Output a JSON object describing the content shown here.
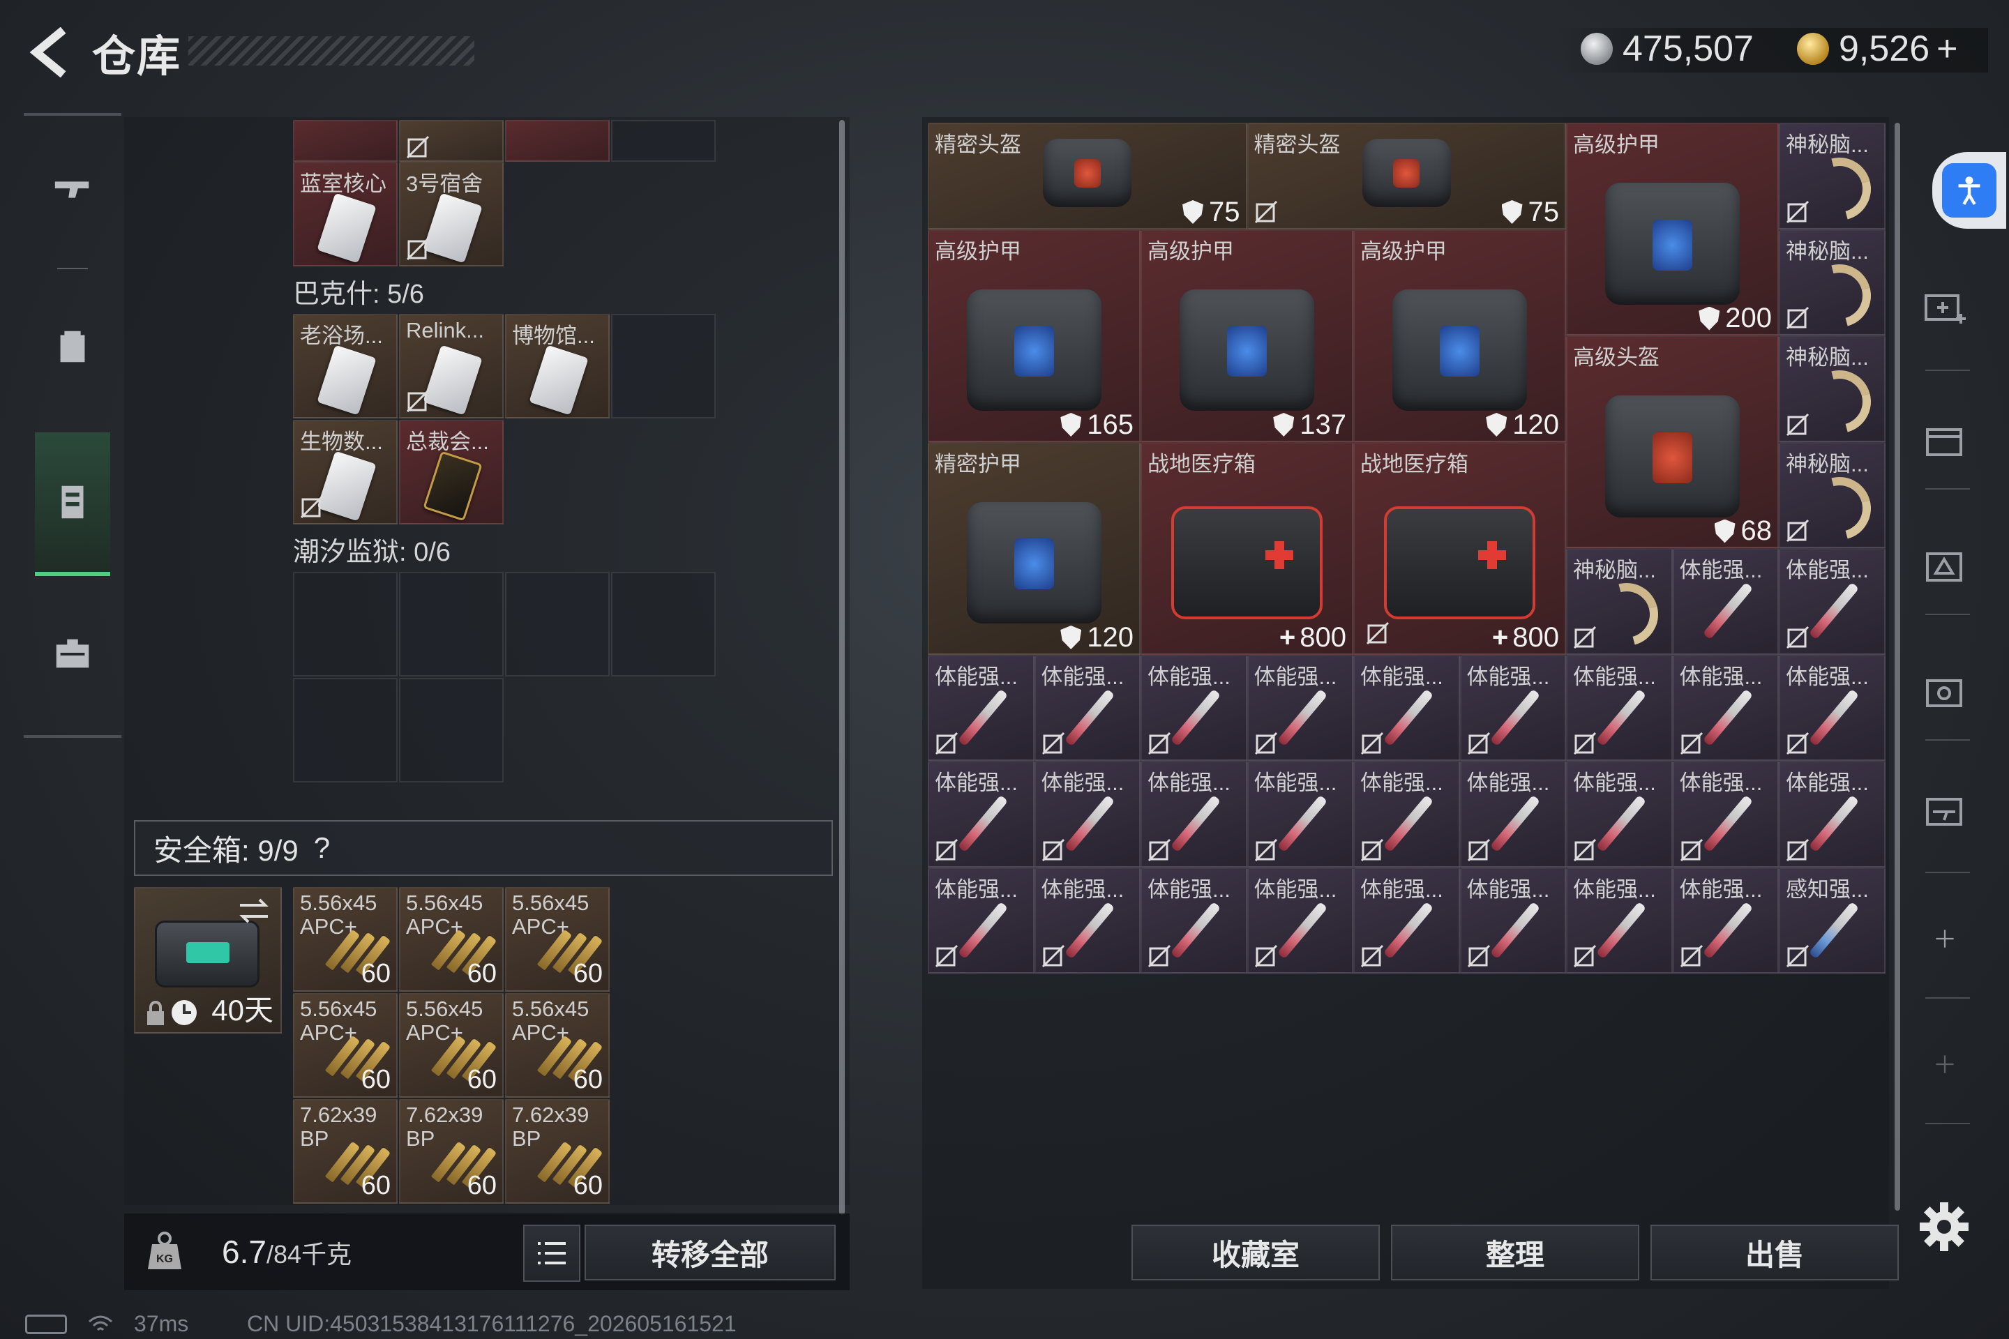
{
  "header": {
    "title": "仓库",
    "silver": "475,507",
    "gold": "9,526",
    "gold_plus": "+"
  },
  "left": {
    "top_row_partial": [
      {
        "color": "red"
      },
      {
        "color": "brown",
        "locked": true
      },
      {
        "color": "red"
      }
    ],
    "row1": [
      {
        "label": "蓝室核心",
        "color": "red"
      },
      {
        "label": "3号宿舍",
        "color": "brown",
        "locked": true
      }
    ],
    "section_baks": "巴克什: 5/6",
    "row2": [
      {
        "label": "老浴场...",
        "color": "brown"
      },
      {
        "label": "Relink...",
        "color": "brown",
        "locked": true
      },
      {
        "label": "博物馆...",
        "color": "brown"
      }
    ],
    "row3": [
      {
        "label": "生物数...",
        "color": "brown",
        "locked": true
      },
      {
        "label": "总裁会...",
        "color": "red",
        "black": true
      }
    ],
    "section_tide": "潮汐监狱: 0/6",
    "safebox": {
      "label": "安全箱: 9/9",
      "help": "?",
      "days": "40天"
    },
    "ammo": [
      {
        "l1": "5.56x45",
        "l2": "APC+",
        "count": "60"
      },
      {
        "l1": "5.56x45",
        "l2": "APC+",
        "count": "60"
      },
      {
        "l1": "5.56x45",
        "l2": "APC+",
        "count": "60"
      },
      {
        "l1": "5.56x45",
        "l2": "APC+",
        "count": "60"
      },
      {
        "l1": "5.56x45",
        "l2": "APC+",
        "count": "60"
      },
      {
        "l1": "5.56x45",
        "l2": "APC+",
        "count": "60"
      },
      {
        "l1": "7.62x39",
        "l2": "BP",
        "count": "60"
      },
      {
        "l1": "7.62x39",
        "l2": "BP",
        "count": "60"
      },
      {
        "l1": "7.62x39",
        "l2": "BP",
        "count": "60"
      }
    ],
    "weight": {
      "value": "6.7",
      "max": "/84",
      "unit": "千克"
    },
    "transfer_all": "转移全部"
  },
  "right": {
    "items": {
      "h1": {
        "label": "精密头盔",
        "value": "75"
      },
      "h2": {
        "label": "精密头盔",
        "value": "75"
      },
      "a_top": {
        "label": "高级护甲",
        "value": "200"
      },
      "m1": {
        "label": "神秘脑..."
      },
      "m2": {
        "label": "神秘脑..."
      },
      "m3": {
        "label": "神秘脑..."
      },
      "m4": {
        "label": "神秘脑..."
      },
      "m5": {
        "label": "神秘脑..."
      },
      "a1": {
        "label": "高级护甲",
        "value": "165"
      },
      "a2": {
        "label": "高级护甲",
        "value": "137"
      },
      "a3": {
        "label": "高级护甲",
        "value": "120"
      },
      "hh": {
        "label": "高级头盔",
        "value": "68"
      },
      "pa": {
        "label": "精密护甲",
        "value": "120"
      },
      "mk1": {
        "label": "战地医疗箱",
        "value": "800"
      },
      "mk2": {
        "label": "战地医疗箱",
        "value": "800"
      },
      "s_label": "体能强...",
      "s_last_label": "感知强..."
    },
    "buttons": {
      "collection": "收藏室",
      "organize": "整理",
      "sell": "出售"
    }
  },
  "status": {
    "ping": "37ms",
    "uid": "CN UID:45031538413176111276_202605161521"
  },
  "colors": {
    "accent_green": "#4fcf82",
    "accessibility_blue": "#2f7df4",
    "red_bg": "#5a2b2e",
    "brown_bg": "#4e3e30"
  }
}
